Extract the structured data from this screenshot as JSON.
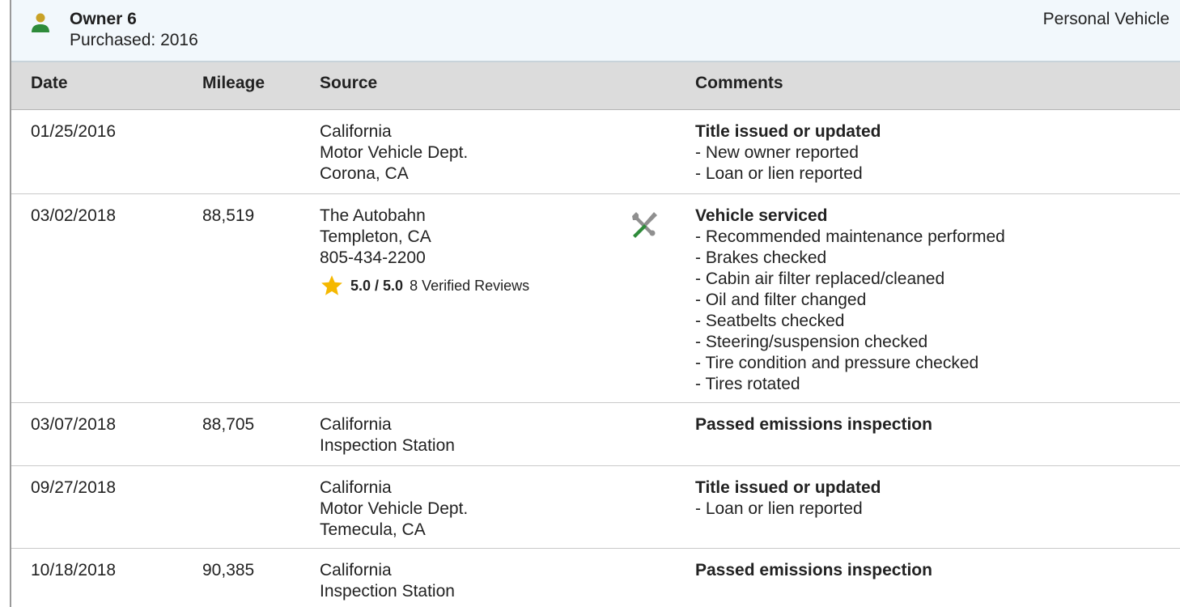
{
  "owner": {
    "name": "Owner 6",
    "purchased": "Purchased: 2016",
    "usage": "Personal Vehicle"
  },
  "table": {
    "headers": {
      "date": "Date",
      "mileage": "Mileage",
      "source": "Source",
      "comments": "Comments"
    },
    "rows": [
      {
        "date": "01/25/2016",
        "mileage": "",
        "source": [
          "California",
          "Motor Vehicle Dept.",
          "Corona, CA"
        ],
        "comment_title": "Title issued or updated",
        "comment_items": [
          "- New owner reported",
          "- Loan or lien reported"
        ]
      },
      {
        "date": "03/02/2018",
        "mileage": "88,519",
        "source": [
          "The Autobahn",
          "Templeton, CA",
          "805-434-2200"
        ],
        "rating": {
          "score": "5.0 / 5.0",
          "reviews": "8 Verified Reviews"
        },
        "icon": "service-wrench-screwdriver-icon",
        "comment_title": "Vehicle serviced",
        "comment_items": [
          "- Recommended maintenance performed",
          "- Brakes checked",
          "- Cabin air filter replaced/cleaned",
          "- Oil and filter changed",
          "- Seatbelts checked",
          "- Steering/suspension checked",
          "- Tire condition and pressure checked",
          "- Tires rotated"
        ]
      },
      {
        "date": "03/07/2018",
        "mileage": "88,705",
        "source": [
          "California",
          "Inspection Station"
        ],
        "comment_title": "Passed emissions inspection",
        "comment_items": []
      },
      {
        "date": "09/27/2018",
        "mileage": "",
        "source": [
          "California",
          "Motor Vehicle Dept.",
          "Temecula, CA"
        ],
        "comment_title": "Title issued or updated",
        "comment_items": [
          "- Loan or lien reported"
        ]
      },
      {
        "date": "10/18/2018",
        "mileage": "90,385",
        "source": [
          "California",
          "Inspection Station"
        ],
        "comment_title": "Passed emissions inspection",
        "comment_items": []
      }
    ]
  },
  "colors": {
    "owner_icon_head": "#c9a227",
    "owner_icon_body": "#2e8b3a",
    "star": "#f5b800",
    "wrench_grey": "#8f8f8f",
    "screwdriver_green": "#2e8b3a"
  }
}
